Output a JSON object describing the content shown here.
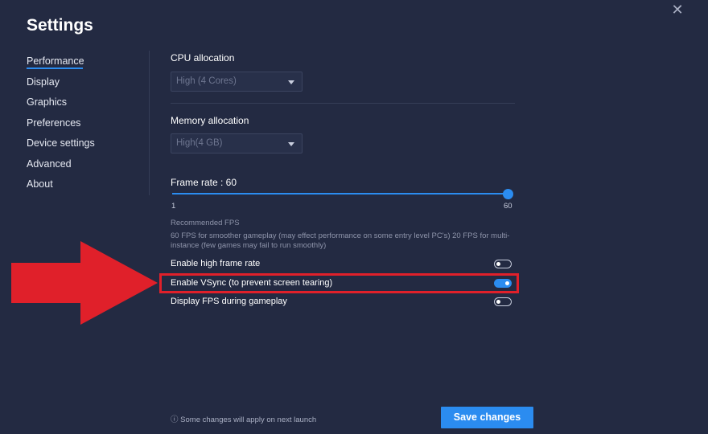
{
  "window": {
    "title": "Settings",
    "close_icon": "close-icon"
  },
  "sidebar": {
    "items": [
      {
        "label": "Performance",
        "active": true
      },
      {
        "label": "Display"
      },
      {
        "label": "Graphics"
      },
      {
        "label": "Preferences"
      },
      {
        "label": "Device settings"
      },
      {
        "label": "Advanced"
      },
      {
        "label": "About"
      }
    ]
  },
  "performance": {
    "cpu": {
      "label": "CPU allocation",
      "value": "High (4 Cores)"
    },
    "memory": {
      "label": "Memory allocation",
      "value": "High(4 GB)"
    },
    "frame_rate": {
      "label": "Frame rate : 60",
      "min": "1",
      "max": "60",
      "value": 60
    },
    "recommended": {
      "title": "Recommended FPS",
      "description": "60 FPS for smoother gameplay (may effect performance on some entry level PC's) 20 FPS for multi-instance (few games may fail to run smoothly)"
    },
    "options": [
      {
        "label": "Enable high frame rate",
        "enabled": false
      },
      {
        "label": "Enable VSync (to prevent screen tearing)",
        "enabled": true,
        "highlighted": true
      },
      {
        "label": "Display FPS during gameplay",
        "enabled": false
      }
    ]
  },
  "footer": {
    "note": "Some changes will apply on next launch",
    "info_icon": "info-icon",
    "save_label": "Save changes"
  },
  "annotation": {
    "arrow_icon": "red-arrow-icon",
    "color": "#e0202a"
  },
  "colors": {
    "background": "#232a42",
    "accent": "#2b8cf0"
  }
}
